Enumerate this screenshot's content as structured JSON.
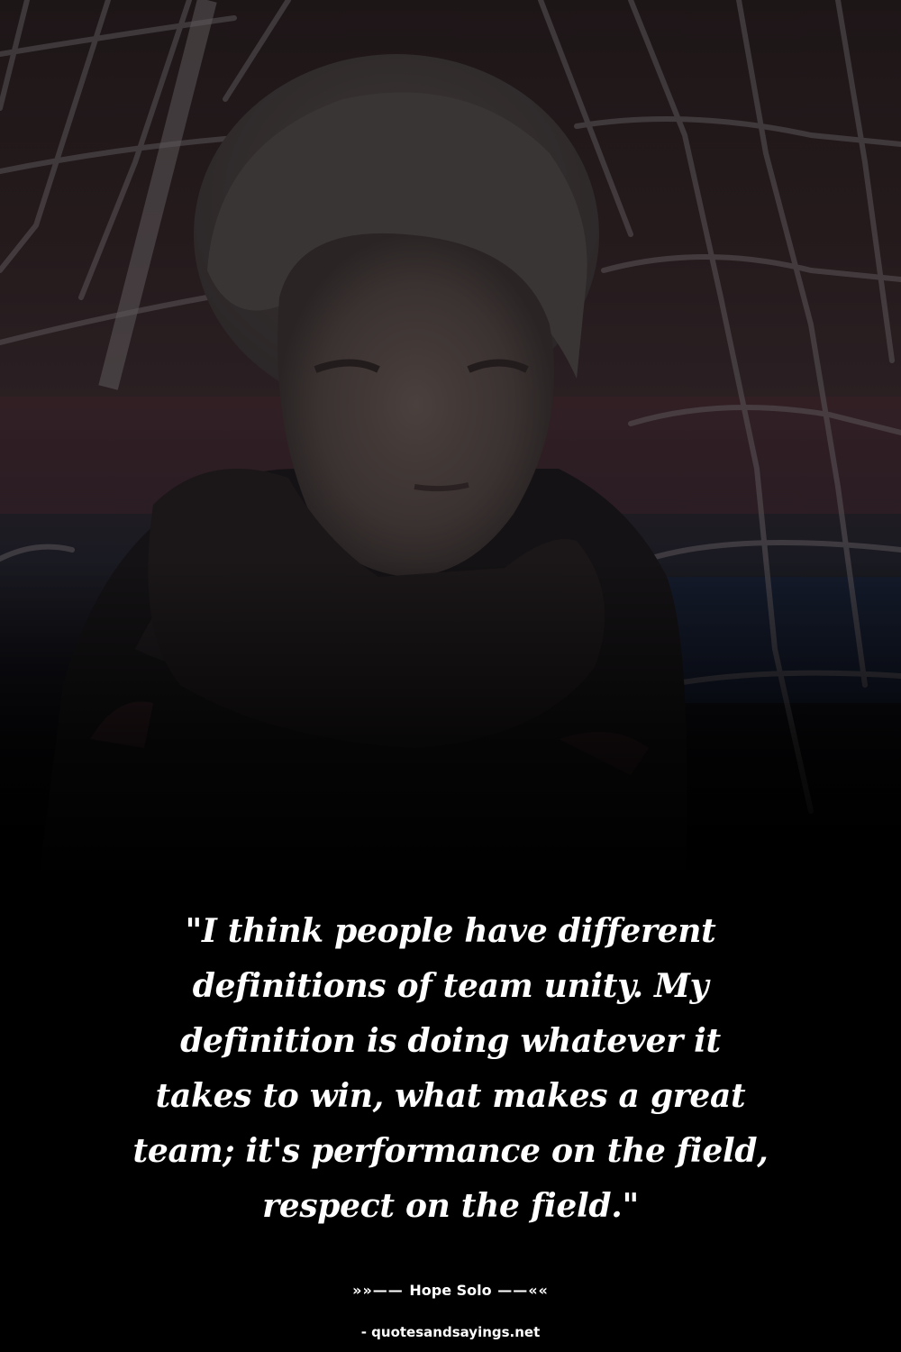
{
  "quote": {
    "text": "\"I think people have different definitions of team unity. My definition is doing whatever it takes to win, what makes a great team; it's performance on the field, respect on the field.\"",
    "lines": [
      "\"I think people have different",
      "definitions of team unity. My",
      "definition is doing whatever it",
      "takes to win, what makes a great",
      "team; it's performance on the field,",
      "respect on the field.\""
    ]
  },
  "author": {
    "prefix": "»»—— ",
    "name": "Hope Solo",
    "suffix": " ——««"
  },
  "source": "- quotesandsayings.net",
  "colors": {
    "background": "#000000",
    "text": "#ffffff"
  },
  "image": {
    "subject": "dim-photo-goalkeeper-behind-net-icon"
  }
}
